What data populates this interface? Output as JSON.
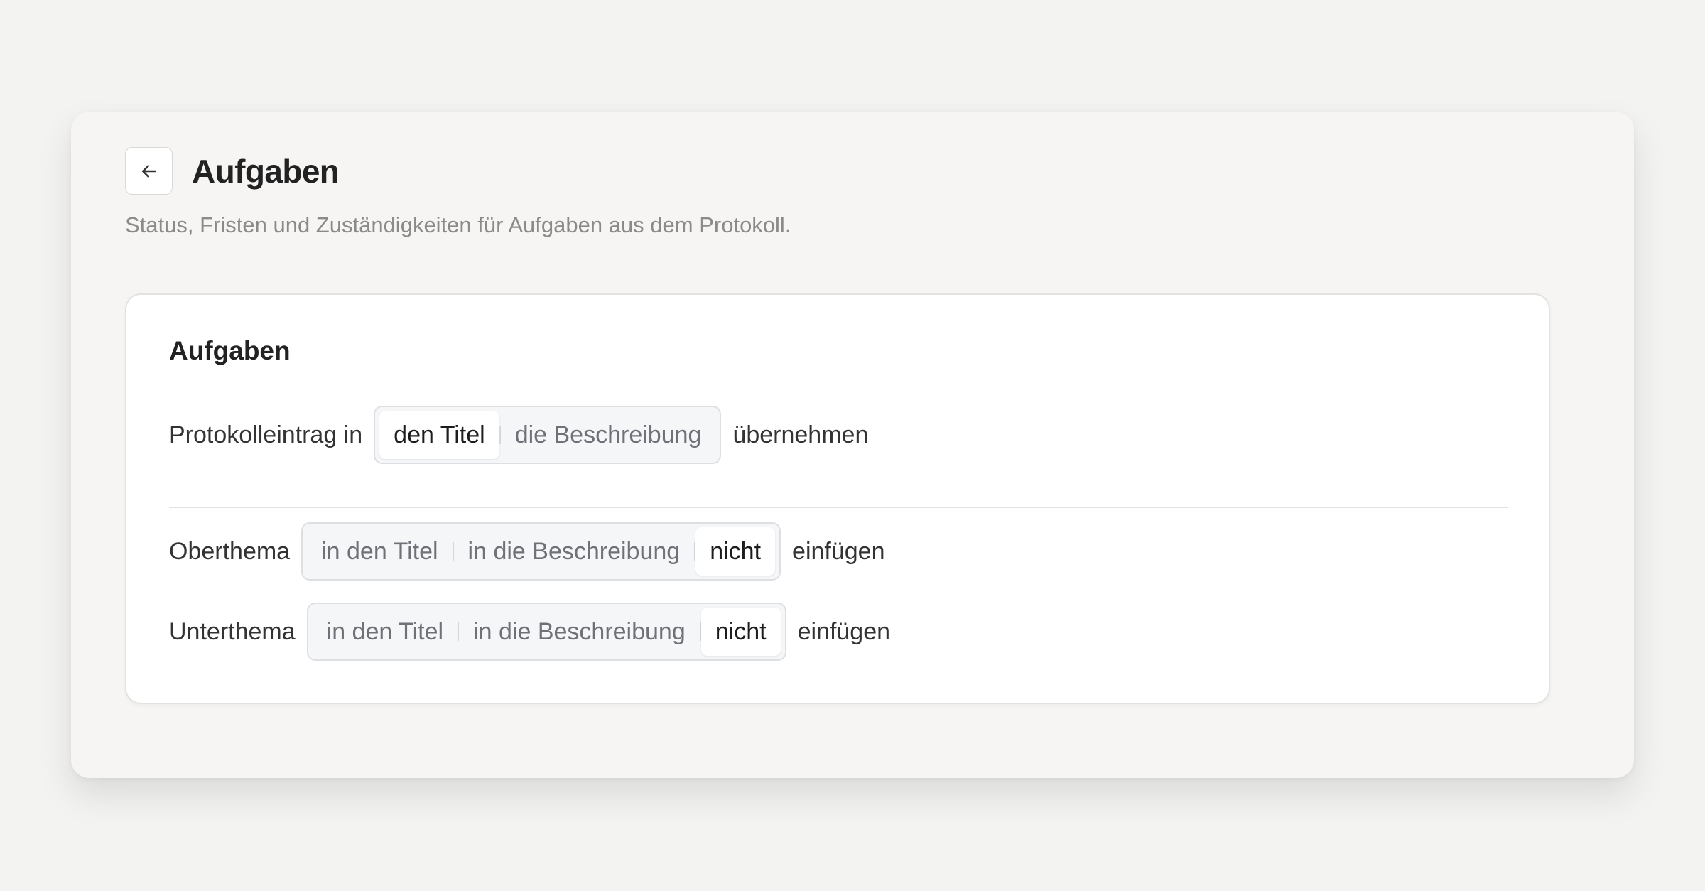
{
  "header": {
    "title": "Aufgaben",
    "subtitle": "Status, Fristen und Zuständigkeiten für Aufgaben aus dem Protokoll."
  },
  "card": {
    "title": "Aufgaben",
    "protokoll": {
      "prefix": "Protokolleintrag in",
      "options": [
        "den Titel",
        "die Beschreibung"
      ],
      "selected": "den Titel",
      "suffix": "übernehmen"
    },
    "oberthema": {
      "prefix": "Oberthema",
      "options": [
        "in den Titel",
        "in die Beschreibung",
        "nicht"
      ],
      "selected": "nicht",
      "suffix": "einfügen"
    },
    "unterthema": {
      "prefix": "Unterthema",
      "options": [
        "in den Titel",
        "in die Beschreibung",
        "nicht"
      ],
      "selected": "nicht",
      "suffix": "einfügen"
    }
  },
  "icons": {
    "back": "arrow-left-icon"
  },
  "colors": {
    "background": "#f3f3f2",
    "panel": "#f6f5f3",
    "card": "#ffffff",
    "segment_bg": "#f5f6f8",
    "text_muted": "#8a8a88"
  }
}
